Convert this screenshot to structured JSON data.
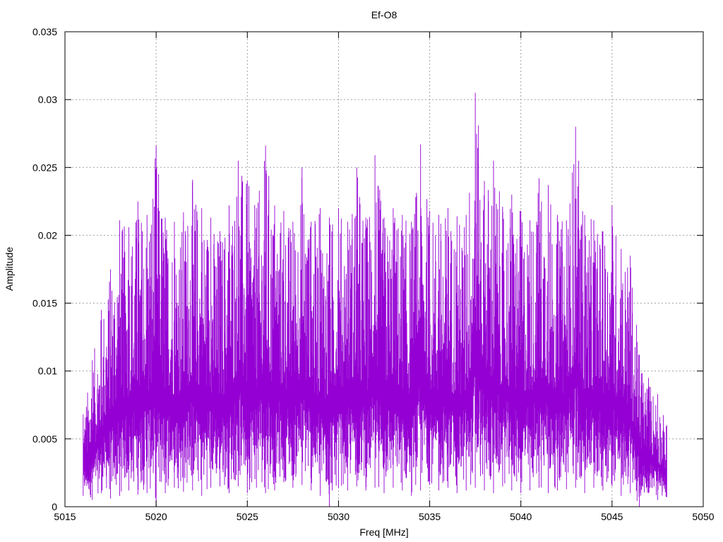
{
  "chart_data": {
    "type": "line",
    "title": "Ef-O8",
    "xlabel": "Freq [MHz]",
    "ylabel": "Amplitude",
    "xlim": [
      5015,
      5050
    ],
    "ylim": [
      0,
      0.035
    ],
    "x_ticks": [
      "5015",
      "5020",
      "5025",
      "5030",
      "5035",
      "5040",
      "5045",
      "5050"
    ],
    "y_ticks": [
      "0",
      "0.005",
      "0.01",
      "0.015",
      "0.02",
      "0.025",
      "0.03",
      "0.035"
    ],
    "grid": true,
    "series": [
      {
        "color": "#9400d3",
        "x": [
          5016.0,
          5016.5,
          5017.0,
          5017.5,
          5018.0,
          5018.5,
          5019.0,
          5019.5,
          5020.0,
          5020.5,
          5021.0,
          5021.5,
          5022.0,
          5022.5,
          5023.0,
          5023.5,
          5024.0,
          5024.5,
          5025.0,
          5025.5,
          5026.0,
          5026.5,
          5027.0,
          5027.5,
          5028.0,
          5028.5,
          5029.0,
          5029.5,
          5030.0,
          5030.5,
          5031.0,
          5031.5,
          5032.0,
          5032.5,
          5033.0,
          5033.5,
          5034.0,
          5034.5,
          5035.0,
          5035.5,
          5036.0,
          5036.5,
          5037.0,
          5037.5,
          5038.0,
          5038.5,
          5039.0,
          5039.5,
          5040.0,
          5040.5,
          5041.0,
          5041.5,
          5042.0,
          5042.5,
          5043.0,
          5043.5,
          5044.0,
          5044.5,
          5045.0,
          5045.5,
          5046.0,
          5046.5,
          5047.0,
          5047.5,
          5048.0
        ],
        "y_max": [
          0.0068,
          0.0108,
          0.0145,
          0.0175,
          0.0211,
          0.0206,
          0.0225,
          0.0215,
          0.0266,
          0.0213,
          0.021,
          0.0217,
          0.0241,
          0.022,
          0.0213,
          0.0203,
          0.0222,
          0.0255,
          0.024,
          0.022,
          0.0266,
          0.0222,
          0.0218,
          0.021,
          0.025,
          0.021,
          0.022,
          0.0213,
          0.022,
          0.021,
          0.025,
          0.0213,
          0.0259,
          0.0213,
          0.022,
          0.0215,
          0.021,
          0.0267,
          0.0218,
          0.0215,
          0.022,
          0.0214,
          0.0215,
          0.0305,
          0.024,
          0.0255,
          0.0221,
          0.023,
          0.0218,
          0.0211,
          0.0242,
          0.0237,
          0.0215,
          0.0211,
          0.028,
          0.0215,
          0.0211,
          0.0203,
          0.0222,
          0.019,
          0.0185,
          0.0112,
          0.0095,
          0.0083,
          0.006
        ],
        "y_min": [
          0.0008,
          0.0005,
          0.001,
          0.0006,
          0.0008,
          0.0012,
          0.0009,
          0.001,
          0.0,
          0.001,
          0.0014,
          0.0011,
          0.0012,
          0.0008,
          0.0014,
          0.0015,
          0.001,
          0.0015,
          0.001,
          0.0014,
          0.001,
          0.0012,
          0.0018,
          0.0014,
          0.0016,
          0.0012,
          0.0008,
          0.0,
          0.0014,
          0.0012,
          0.0015,
          0.0012,
          0.0014,
          0.001,
          0.0014,
          0.0012,
          0.0008,
          0.0012,
          0.0016,
          0.0012,
          0.0014,
          0.001,
          0.0012,
          0.0014,
          0.0012,
          0.001,
          0.0015,
          0.0012,
          0.001,
          0.0012,
          0.0014,
          0.001,
          0.0012,
          0.0013,
          0.0014,
          0.001,
          0.0014,
          0.0012,
          0.0015,
          0.0008,
          0.001,
          0.0,
          0.001,
          0.0005,
          0.0007
        ]
      }
    ]
  }
}
